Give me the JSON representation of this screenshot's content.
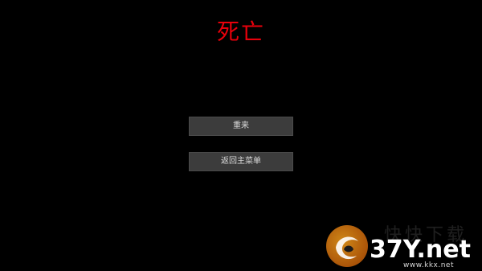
{
  "screen": {
    "title": "死亡",
    "background_color": "#000000",
    "title_color": "#e8000b"
  },
  "menu": {
    "retry_label": "重来",
    "main_menu_label": "返回主菜单",
    "button_color": "#3c3c3c",
    "button_text_color": "#dcdcdc"
  },
  "watermark": {
    "logo_icon": "swirl-logo-icon",
    "brand_text": "37Y.net",
    "url_text": "www.kkx.net",
    "faint_text": "快快下载"
  }
}
